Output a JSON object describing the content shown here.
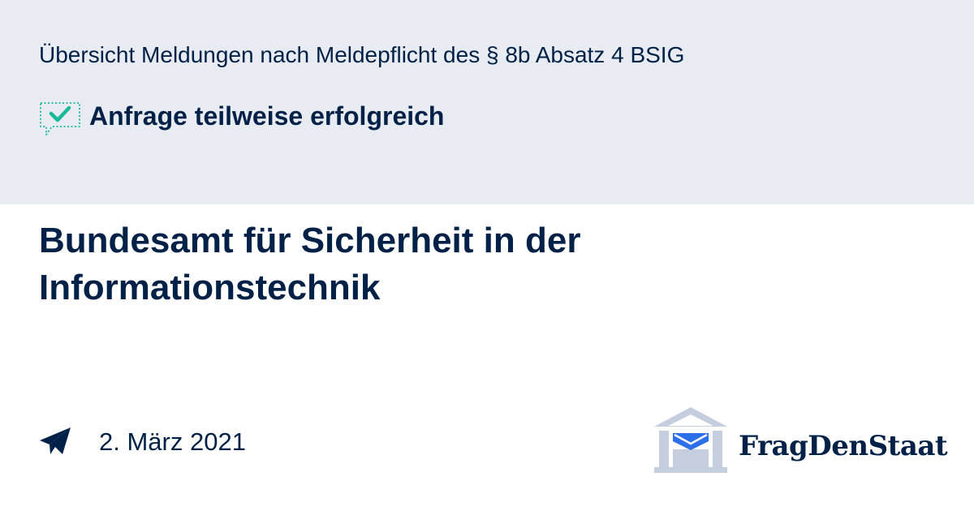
{
  "request": {
    "title": "Übersicht Meldungen nach Meldepflicht des § 8b Absatz 4 BSIG",
    "status": "Anfrage teilweise erfolgreich"
  },
  "authority": {
    "name": "Bundesamt für Sicherheit in der Informationstechnik"
  },
  "meta": {
    "date": "2. März 2021"
  },
  "brand": {
    "name": "FragDenStaat"
  },
  "icons": {
    "status": "speech-bubble-check-icon",
    "date": "paper-plane-icon",
    "logo": "building-envelope-logo"
  },
  "colors": {
    "navy": "#002147",
    "band": "#e8ebf1",
    "success": "#16b99a",
    "logo_gray": "#c5cede",
    "logo_blue": "#2c6fe8"
  }
}
